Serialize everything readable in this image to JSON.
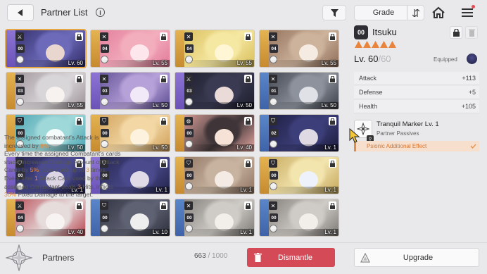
{
  "header": {
    "title": "Partner List",
    "info_icon": "info-icon",
    "filter_icon": "filter-icon",
    "sort_label": "Grade",
    "sort_order_icon": "sort-order-icon",
    "home_icon": "home-icon",
    "menu_icon": "menu-icon"
  },
  "grid": {
    "cards": [
      {
        "badge": "00",
        "level": "Lv. 60",
        "locked": true,
        "selected": true,
        "type": "blade",
        "side": "purple",
        "art": [
          "#6d6ab9",
          "#2f2a66",
          "#e9d6ce"
        ]
      },
      {
        "badge": "04",
        "level": "Lv. 55",
        "locked": true,
        "type": "sword",
        "side": "gold",
        "art": [
          "#f3aebd",
          "#e27a9a",
          "#fde7ec"
        ]
      },
      {
        "badge": "04",
        "level": "Lv. 55",
        "locked": true,
        "type": "sword",
        "side": "gold",
        "art": [
          "#f5e8a2",
          "#d9be5a",
          "#fff6d6"
        ]
      },
      {
        "badge": "04",
        "level": "Lv. 55",
        "locked": true,
        "type": "sword",
        "side": "gold",
        "art": [
          "#cdb39c",
          "#8e6c56",
          "#f6ebe2"
        ]
      },
      {
        "badge": "03",
        "level": "Lv. 55",
        "locked": true,
        "type": "sword",
        "side": "gold",
        "art": [
          "#d9d6d9",
          "#9b8f95",
          "#f7f1f0"
        ]
      },
      {
        "badge": "03",
        "level": "Lv. 50",
        "locked": true,
        "type": "sword",
        "side": "purple",
        "art": [
          "#b7a1d9",
          "#5a4b91",
          "#f1e9f8"
        ]
      },
      {
        "badge": "03",
        "level": "Lv. 50",
        "locked": true,
        "type": "blade",
        "side": "purple",
        "art": [
          "#3a3a52",
          "#1d1d2c",
          "#eadbd8"
        ]
      },
      {
        "badge": "01",
        "level": "Lv. 50",
        "locked": true,
        "type": "sword",
        "side": "blue",
        "art": [
          "#8d929c",
          "#3c3f49",
          "#dfe1e6"
        ]
      },
      {
        "badge": "00",
        "level": "Lv. 50",
        "locked": true,
        "type": "shield",
        "side": "gold",
        "art": [
          "#9fd8d9",
          "#4aa3b2",
          "#f4fbfb"
        ]
      },
      {
        "badge": "00",
        "level": "Lv. 50",
        "locked": true,
        "type": "shield",
        "side": "gold",
        "art": [
          "#f3d8a6",
          "#cf9f58",
          "#fdf2dd"
        ]
      },
      {
        "badge": "00",
        "level": "Lv. 40",
        "locked": true,
        "type": "gear",
        "side": "gold",
        "art": [
          "#3f3538",
          "#e7a9a2",
          "#f6e2d6"
        ]
      },
      {
        "badge": "02",
        "level": "Lv. 1",
        "locked": true,
        "type": "shield",
        "side": "blue",
        "art": [
          "#3c3e79",
          "#1c1c3c",
          "#ded9e2"
        ]
      },
      {
        "badge": "00",
        "level": "Lv. 1",
        "locked": true,
        "type": "shield",
        "side": "purple",
        "art": [
          "#4b4b90",
          "#22224a",
          "#dcd6e4"
        ]
      },
      {
        "badge": "00",
        "level": "Lv. 1",
        "locked": true,
        "type": "shield",
        "side": "purple",
        "art": [
          "#4a4a8c",
          "#22224a",
          "#e0dbe6"
        ]
      },
      {
        "badge": "00",
        "level": "Lv. 1",
        "locked": true,
        "type": "shield",
        "side": "gold",
        "art": [
          "#c7b39f",
          "#8f7462",
          "#f4ece4"
        ]
      },
      {
        "badge": "00",
        "level": "Lv. 1",
        "locked": true,
        "type": "shield",
        "side": "gold",
        "art": [
          "#f3e5ae",
          "#c4a55a",
          "#eef2fb"
        ]
      },
      {
        "badge": "04",
        "level": "Lv. 40",
        "locked": true,
        "type": "blade",
        "side": "gold",
        "art": [
          "#e6dcdc",
          "#b7444f",
          "#f8f3f3"
        ]
      },
      {
        "badge": "00",
        "level": "Lv. 10",
        "locked": true,
        "type": "shield",
        "side": "blue",
        "art": [
          "#5f6273",
          "#2d2f3c",
          "#eeeeee"
        ]
      },
      {
        "badge": "00",
        "level": "Lv. 1",
        "locked": true,
        "type": "sword",
        "side": "blue",
        "art": [
          "#cfcbc6",
          "#7c7874",
          "#f2efea"
        ]
      },
      {
        "badge": "00",
        "level": "Lv. 1",
        "locked": true,
        "type": "sword",
        "side": "blue",
        "art": [
          "#cfcbc6",
          "#7c7874",
          "#f2efea"
        ]
      }
    ]
  },
  "detail": {
    "grade_badge": "00",
    "name": "Itsuku",
    "stars": 5,
    "level": "Lv. 60",
    "level_sep": "/",
    "level_max": "60",
    "equipped_label": "Equipped",
    "stats": [
      {
        "label": "Attack",
        "value": "+113"
      },
      {
        "label": "Defense",
        "value": "+5"
      },
      {
        "label": "Health",
        "value": "+105"
      }
    ],
    "passive": {
      "title": "Tranquil Marker Lv. 1",
      "subtitle": "Partner Passives",
      "effect": "Psionic Additional Effect"
    },
    "description": {
      "p1a": "The assigned combatant's Attack is increased by ",
      "p1b": "8%",
      "p1c": ".",
      "p2a": "Every time the assigned Combatant's cards stack, increases Damage Amount of Attack Cards by ",
      "p2b": "5%",
      "p2c": ". Can stack up to ",
      "p2d": "3",
      "p2e": " times.",
      "p3a": "Every time ",
      "p3b": "1",
      "p3c": " Attack Card used by the assigned Combatant deals ",
      "p3d": "3",
      "p3e": " Hits, inflicts ",
      "p3f": "30%",
      "p3g": " Fixed Damage to the target."
    }
  },
  "footer": {
    "partners_label": "Partners",
    "capacity_current": "663",
    "capacity_sep": " / ",
    "capacity_max": "1000",
    "dismantle_label": "Dismantle",
    "upgrade_label": "Upgrade"
  },
  "colors": {
    "accent_orange": "#e58a3e",
    "dismantle_red": "#d44b57",
    "selected_outline": "#e6a640"
  }
}
